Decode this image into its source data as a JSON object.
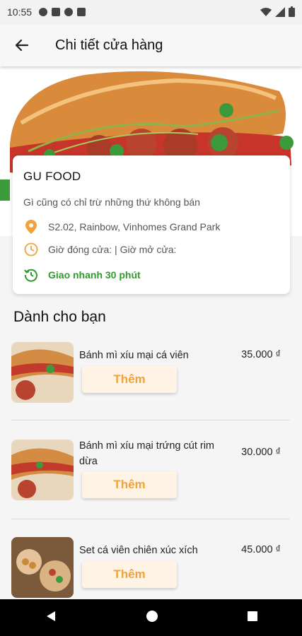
{
  "status_bar": {
    "time": "10:55"
  },
  "app_bar": {
    "title": "Chi tiết cửa hàng"
  },
  "store": {
    "name": "GU FOOD",
    "description": "Gì cũng có chỉ trừ những thứ không bán",
    "address": "S2.02, Rainbow, Vinhomes Grand Park",
    "hours": "Giờ đóng cửa:  | Giờ mở cửa:",
    "delivery": "Giao nhanh 30 phút"
  },
  "section_title": "Dành cho bạn",
  "items": [
    {
      "name": "Bánh mì xíu mại cá viên",
      "price": "35.000 ₫",
      "button": "Thêm"
    },
    {
      "name": "Bánh mì xíu mại trứng cút rim dừa",
      "price": "30.000 ₫",
      "button": "Thêm"
    },
    {
      "name": "Set cá viên chiên xúc xích",
      "price": "45.000 ₫",
      "button": "Thêm"
    }
  ],
  "colors": {
    "accent": "#f0a33a",
    "green": "#2e9b2a",
    "button_bg": "#fff3e6"
  }
}
